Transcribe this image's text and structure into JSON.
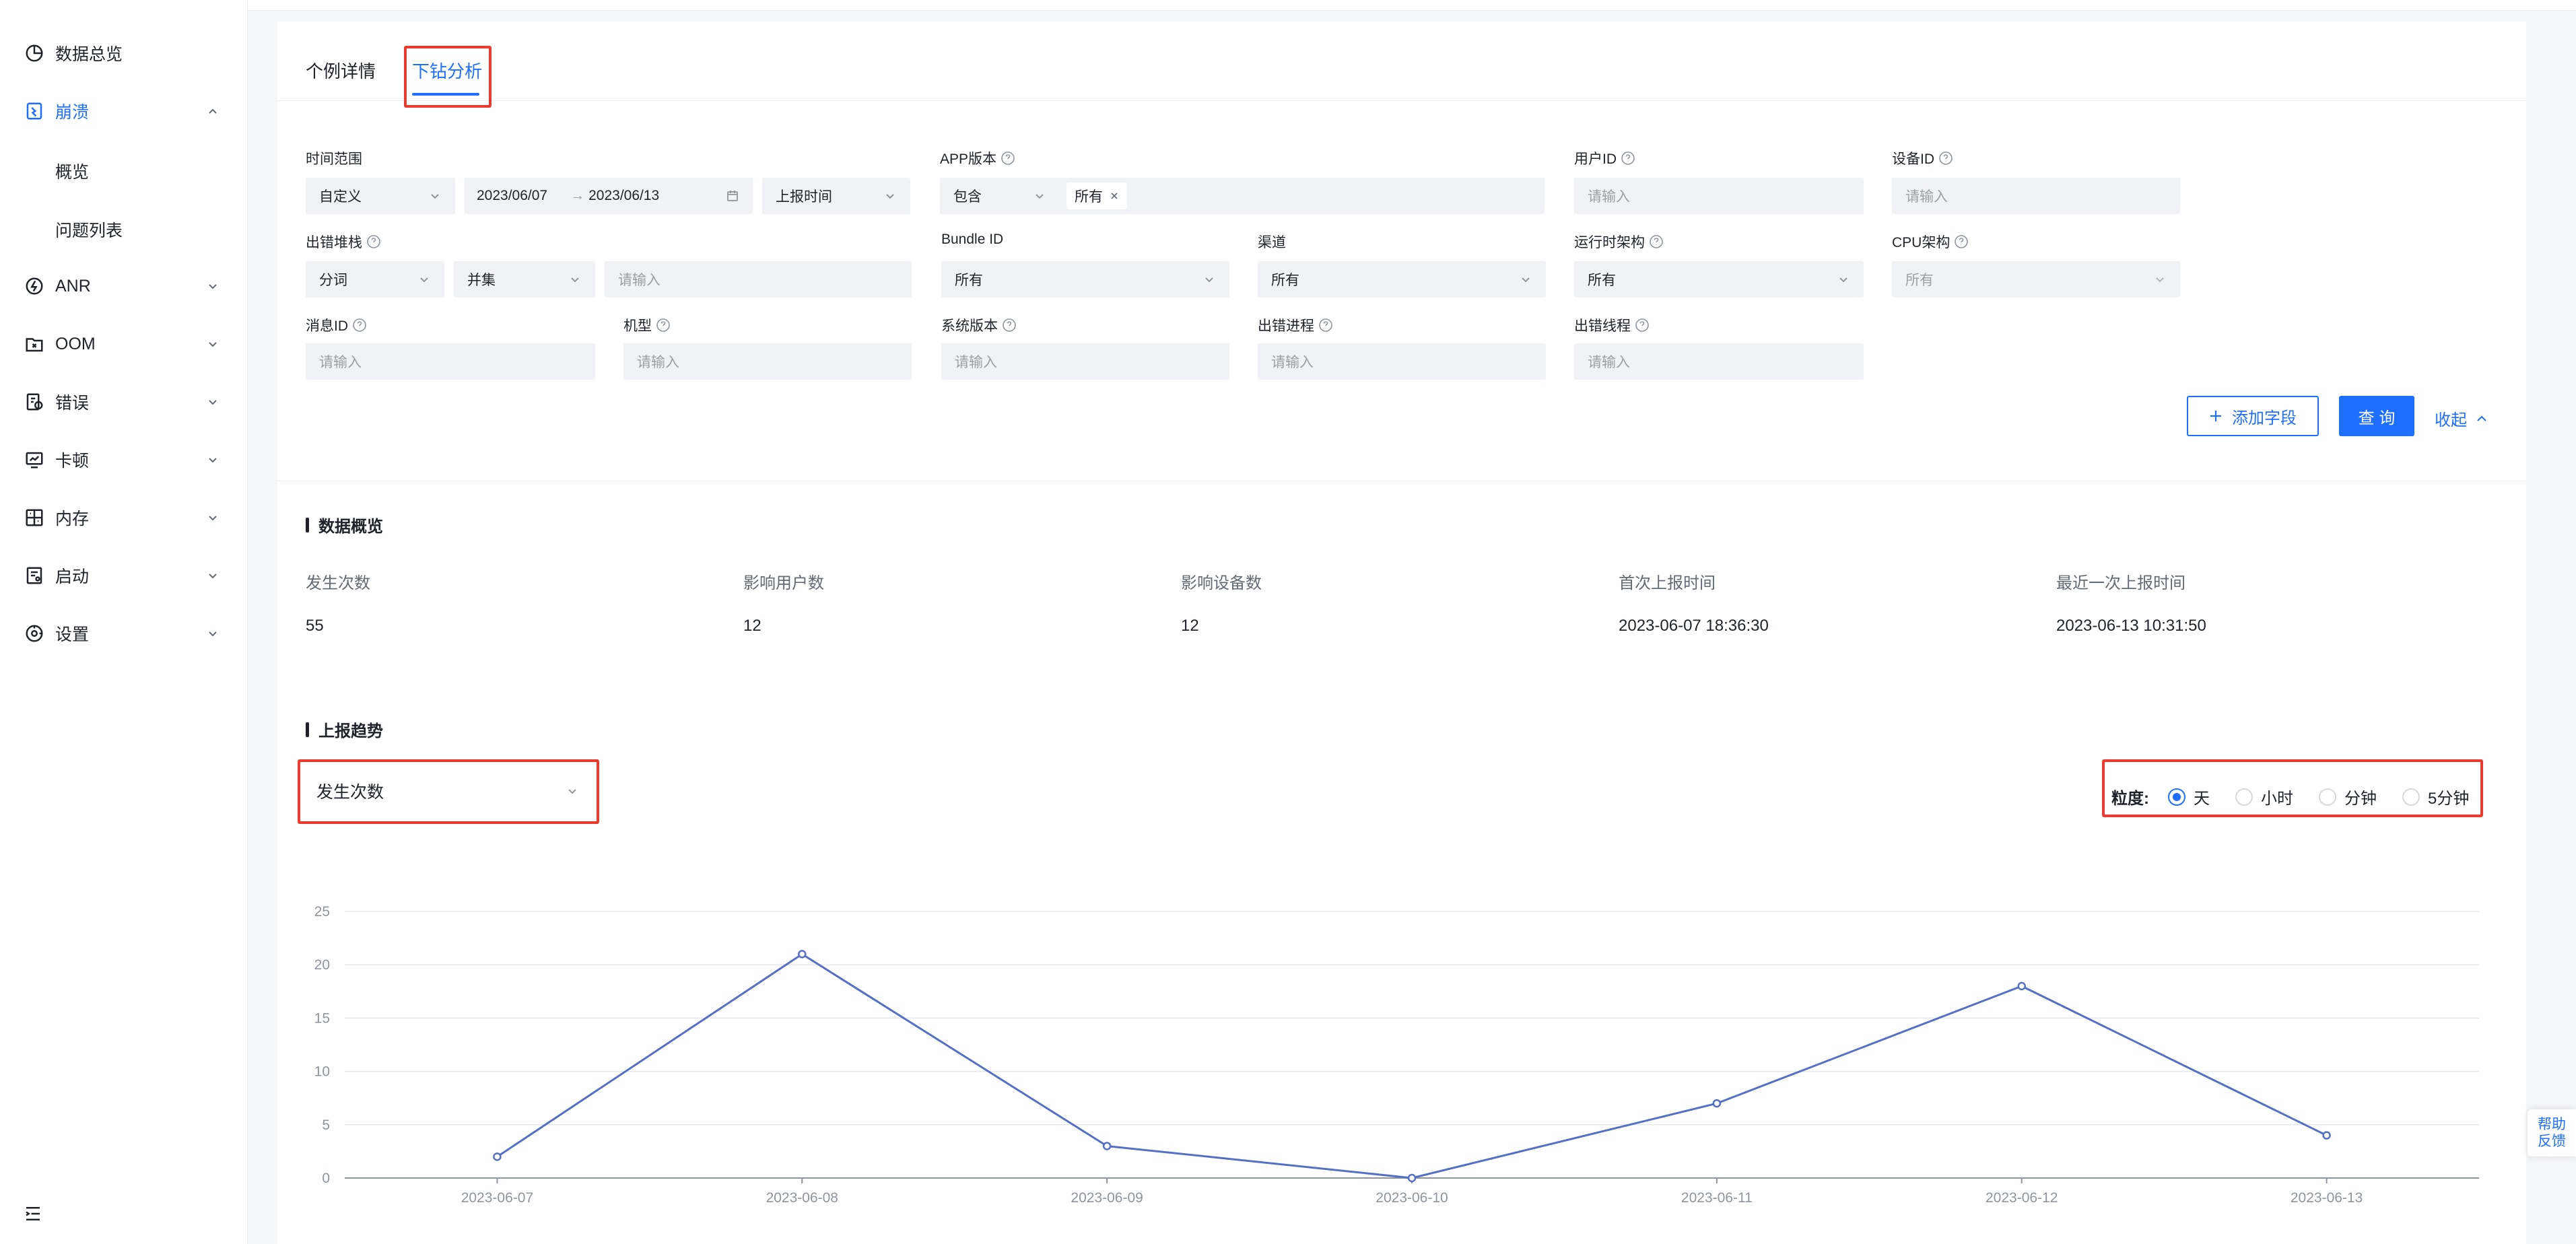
{
  "sidebar": {
    "items": [
      {
        "label": "数据总览"
      },
      {
        "label": "崩溃",
        "sub": [
          "概览",
          "问题列表"
        ]
      },
      {
        "label": "ANR"
      },
      {
        "label": "OOM"
      },
      {
        "label": "错误"
      },
      {
        "label": "卡顿"
      },
      {
        "label": "内存"
      },
      {
        "label": "启动"
      },
      {
        "label": "设置"
      }
    ]
  },
  "tabs": [
    "个例详情",
    "下钻分析"
  ],
  "filters": {
    "time_range": {
      "label": "时间范围",
      "mode": "自定义",
      "start": "2023/06/07",
      "sep": "→",
      "end": "2023/06/13",
      "time_field": "上报时间"
    },
    "app_version": {
      "label": "APP版本",
      "op": "包含",
      "tag": "所有"
    },
    "user_id": {
      "label": "用户ID",
      "placeholder": "请输入"
    },
    "device_id": {
      "label": "设备ID",
      "placeholder": "请输入"
    },
    "stack": {
      "label": "出错堆栈",
      "op1": "分词",
      "op2": "并集",
      "placeholder": "请输入"
    },
    "bundle_id": {
      "label": "Bundle ID",
      "value": "所有"
    },
    "channel": {
      "label": "渠道",
      "value": "所有"
    },
    "runtime_arch": {
      "label": "运行时架构",
      "value": "所有"
    },
    "cpu_arch": {
      "label": "CPU架构",
      "value": "所有"
    },
    "message_id": {
      "label": "消息ID",
      "placeholder": "请输入"
    },
    "model": {
      "label": "机型",
      "placeholder": "请输入"
    },
    "os_version": {
      "label": "系统版本",
      "placeholder": "请输入"
    },
    "process": {
      "label": "出错进程",
      "placeholder": "请输入"
    },
    "thread": {
      "label": "出错线程",
      "placeholder": "请输入"
    }
  },
  "actions": {
    "add_field": "添加字段",
    "query": "查 询",
    "collapse": "收起"
  },
  "overview": {
    "title": "数据概览",
    "stats": [
      {
        "label": "发生次数",
        "value": "55"
      },
      {
        "label": "影响用户数",
        "value": "12"
      },
      {
        "label": "影响设备数",
        "value": "12"
      },
      {
        "label": "首次上报时间",
        "value": "2023-06-07 18:36:30"
      },
      {
        "label": "最近一次上报时间",
        "value": "2023-06-13 10:31:50"
      }
    ]
  },
  "trend": {
    "title": "上报趋势",
    "metric": "发生次数",
    "granularity_label": "粒度:",
    "granularity_options": [
      "天",
      "小时",
      "分钟",
      "5分钟"
    ],
    "granularity_selected": 0
  },
  "help": {
    "line1": "帮助",
    "line2": "反馈"
  },
  "colors": {
    "accent": "#1e6fff",
    "highlight_box": "#ea3b2f",
    "series": "#5470c6"
  },
  "chart_data": {
    "type": "line",
    "x": [
      "2023-06-07",
      "2023-06-08",
      "2023-06-09",
      "2023-06-10",
      "2023-06-11",
      "2023-06-12",
      "2023-06-13"
    ],
    "series": [
      {
        "values": [
          2,
          21,
          3,
          0,
          7,
          18,
          4
        ]
      }
    ],
    "ylim": [
      0,
      25
    ],
    "yticks": [
      0,
      5,
      10,
      15,
      20,
      25
    ],
    "grid": true
  }
}
